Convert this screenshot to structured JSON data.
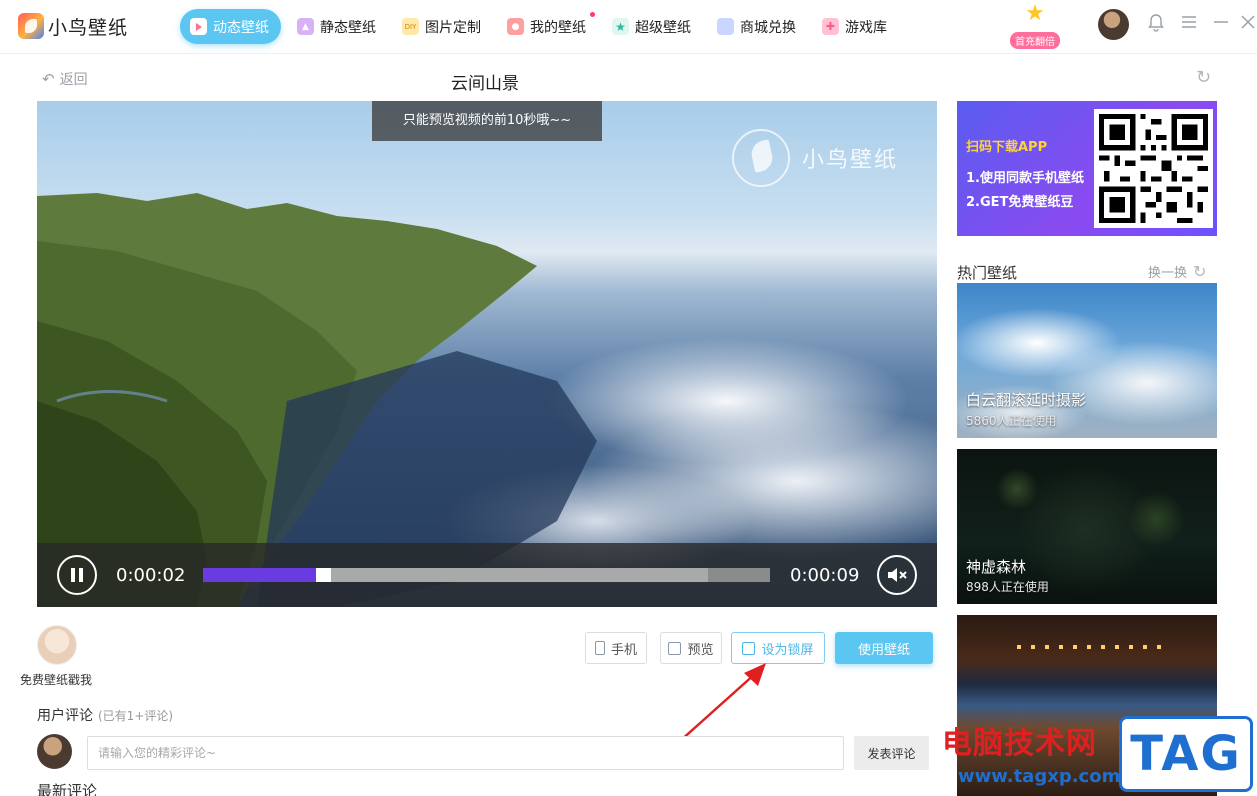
{
  "app": {
    "logo_text": "小鸟壁纸"
  },
  "nav": [
    {
      "label": "动态壁纸",
      "icon": "play-icon",
      "color": "#ff6f8e",
      "active": true
    },
    {
      "label": "静态壁纸",
      "icon": "image-icon",
      "color": "#c28bf0"
    },
    {
      "label": "图片定制",
      "icon": "diy-icon",
      "color": "#ffd97a",
      "badge_text": "DIY"
    },
    {
      "label": "我的壁纸",
      "icon": "user-icon",
      "color": "#ff8a8a",
      "dot": true
    },
    {
      "label": "超级壁纸",
      "icon": "star-icon",
      "color": "#46c9b2"
    },
    {
      "label": "商城兑换",
      "icon": "bag-icon",
      "color": "#8aa6ff"
    },
    {
      "label": "游戏库",
      "icon": "gamepad-icon",
      "color": "#ff8fb0"
    }
  ],
  "promo": {
    "label": "首充翻倍"
  },
  "header": {
    "back_label": "返回",
    "title": "云间山景"
  },
  "video": {
    "toast": "只能预览视频的前10秒哦~~",
    "watermark": "小鸟壁纸",
    "current_time": "0:00:02",
    "duration": "0:00:09",
    "progress": 0.2,
    "buffered": 0.89
  },
  "banner": {
    "title": "扫码下载APP",
    "line1": "1.使用同款手机壁纸",
    "line2": "2.GET免费壁纸豆"
  },
  "hot": {
    "title": "热门壁纸",
    "swap_label": "换一换",
    "cards": [
      {
        "title": "白云翻滚延时摄影",
        "sub": "5860人正在使用"
      },
      {
        "title": "神虚森林",
        "sub": "898人正在使用"
      }
    ]
  },
  "author": {
    "name": "免费壁纸戳我"
  },
  "actions": {
    "phone": "手机",
    "preview": "预览",
    "lock": "设为锁屏",
    "use": "使用壁纸"
  },
  "comments": {
    "title": "用户评论",
    "count": "(已有1+评论)",
    "placeholder": "请输入您的精彩评论~",
    "post_label": "发表评论",
    "latest_title": "最新评论"
  },
  "site_watermark": {
    "text": "电脑技术网",
    "url": "www.tagxp.com",
    "tag": "TAG"
  },
  "colors": {
    "accent": "#5bc6f2",
    "progress": "#6a3be0",
    "annotation_arrow": "#e02020"
  }
}
